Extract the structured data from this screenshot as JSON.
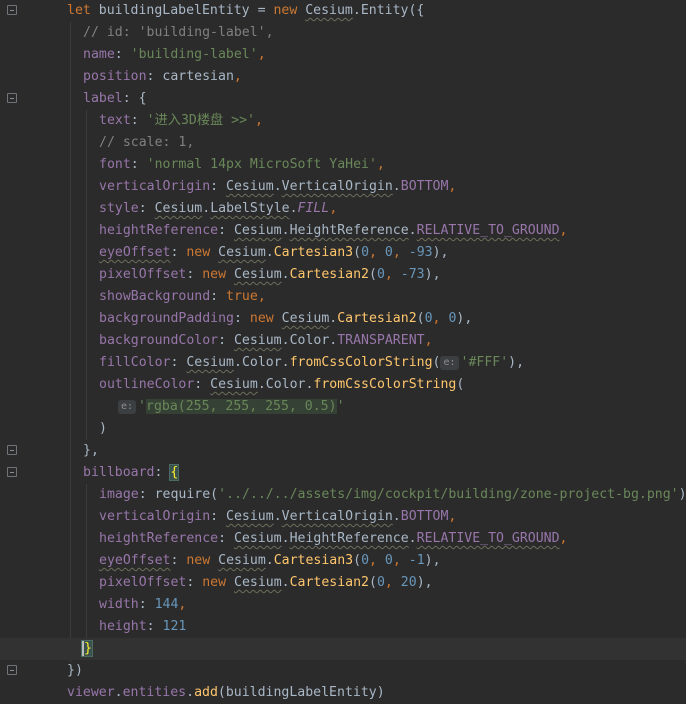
{
  "code": {
    "l1": {
      "a": "let ",
      "b": "buildingLabelEntity",
      "c": " = ",
      "d": "new ",
      "e": "Cesium",
      "f": ".",
      "g": "Entity",
      "h": "({"
    },
    "l2": {
      "a": "// id: 'building-label',"
    },
    "l3": {
      "a": "name",
      "b": ": ",
      "c": "'building-label'",
      "d": ","
    },
    "l4": {
      "a": "position",
      "b": ": ",
      "c": "cartesian",
      "d": ","
    },
    "l5": {
      "a": "label",
      "b": ": {"
    },
    "l6": {
      "a": "text",
      "b": ": ",
      "c": "'进入3D楼盘 >>'",
      "d": ","
    },
    "l7": {
      "a": "// scale: 1,"
    },
    "l8": {
      "a": "font",
      "b": ": ",
      "c": "'normal 14px MicroSoft YaHei'",
      "d": ","
    },
    "l9": {
      "a": "verticalOrigin",
      "b": ": ",
      "c": "Cesium",
      "d": ".",
      "e": "VerticalOrigin",
      "f": ".",
      "g": "BOTTOM",
      "h": ","
    },
    "l10": {
      "a": "style",
      "b": ": ",
      "c": "Cesium",
      "d": ".",
      "e": "LabelStyle",
      "f": ".",
      "g": "FILL",
      "h": ","
    },
    "l11": {
      "a": "heightReference",
      "b": ": ",
      "c": "Cesium",
      "d": ".",
      "e": "HeightReference",
      "f": ".",
      "g": "RELATIVE_TO_GROUND",
      "h": ","
    },
    "l12": {
      "a": "eyeOffset",
      "b": ": ",
      "c": "new ",
      "d": "Cesium",
      "e": ".",
      "f": "Cartesian3",
      "g": "(",
      "h": "0",
      "i": ", ",
      "j": "0",
      "k": ", ",
      "l": "-93",
      "m": "),"
    },
    "l13": {
      "a": "pixelOffset",
      "b": ": ",
      "c": "new ",
      "d": "Cesium",
      "e": ".",
      "f": "Cartesian2",
      "g": "(",
      "h": "0",
      "i": ", ",
      "j": "-73",
      "k": "),"
    },
    "l14": {
      "a": "showBackground",
      "b": ": ",
      "c": "true",
      "d": ","
    },
    "l15": {
      "a": "backgroundPadding",
      "b": ": ",
      "c": "new ",
      "d": "Cesium",
      "e": ".",
      "f": "Cartesian2",
      "g": "(",
      "h": "0",
      "i": ", ",
      "j": "0",
      "k": "),"
    },
    "l16": {
      "a": "backgroundColor",
      "b": ": ",
      "c": "Cesium",
      "d": ".",
      "e": "Color",
      "f": ".",
      "g": "TRANSPARENT",
      "h": ","
    },
    "l17": {
      "a": "fillColor",
      "b": ": ",
      "c": "Cesium",
      "d": ".",
      "e": "Color",
      "f": ".",
      "g": "fromCssColorString",
      "h": "(",
      "hint": "e:",
      "i": "'#FFF'",
      "j": "),"
    },
    "l18": {
      "a": "outlineColor",
      "b": ": ",
      "c": "Cesium",
      "d": ".",
      "e": "Color",
      "f": ".",
      "g": "fromCssColorString",
      "h": "("
    },
    "l19": {
      "hint": "e:",
      "a": "'",
      "b": "rgba(255, 255, 255, 0.5)",
      "c": "'"
    },
    "l20": {
      "a": ")"
    },
    "l21": {
      "a": "},"
    },
    "l22": {
      "a": "billboard",
      "b": ": ",
      "c": "{"
    },
    "l23": {
      "a": "image",
      "b": ": ",
      "c": "require",
      "d": "(",
      "e": "'../../../assets/img/cockpit/building/zone-project-bg.png'",
      "f": ")"
    },
    "l24": {
      "a": "verticalOrigin",
      "b": ": ",
      "c": "Cesium",
      "d": ".",
      "e": "VerticalOrigin",
      "f": ".",
      "g": "BOTTOM",
      "h": ","
    },
    "l25": {
      "a": "heightReference",
      "b": ": ",
      "c": "Cesium",
      "d": ".",
      "e": "HeightReference",
      "f": ".",
      "g": "RELATIVE_TO_GROUND",
      "h": ","
    },
    "l26": {
      "a": "eyeOffset",
      "b": ": ",
      "c": "new ",
      "d": "Cesium",
      "e": ".",
      "f": "Cartesian3",
      "g": "(",
      "h": "0",
      "i": ", ",
      "j": "0",
      "k": ", ",
      "l": "-1",
      "m": "),"
    },
    "l27": {
      "a": "pixelOffset",
      "b": ": ",
      "c": "new ",
      "d": "Cesium",
      "e": ".",
      "f": "Cartesian2",
      "g": "(",
      "h": "0",
      "i": ", ",
      "j": "20",
      "k": "),"
    },
    "l28": {
      "a": "width",
      "b": ": ",
      "c": "144",
      "d": ","
    },
    "l29": {
      "a": "height",
      "b": ": ",
      "c": "121"
    },
    "l30": {
      "a": "}"
    },
    "l31": {
      "a": "})"
    },
    "l32": {
      "a": "viewer",
      "b": ".",
      "c": "entities",
      "d": ".",
      "e": "add",
      "f": "(buildingLabelEntity)"
    }
  }
}
